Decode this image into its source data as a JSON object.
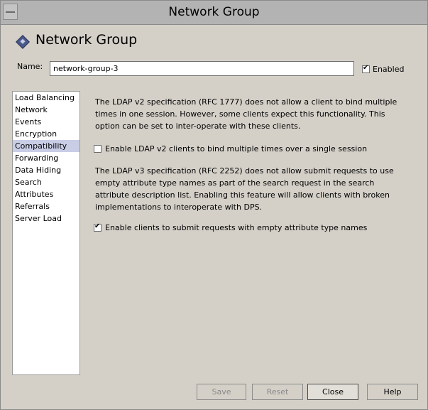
{
  "window": {
    "title": "Network Group"
  },
  "header": {
    "title": "Network Group"
  },
  "name_field": {
    "label": "Name:",
    "value": "network-group-3"
  },
  "enabled_checkbox": {
    "label": "Enabled",
    "checked": true
  },
  "sidebar": {
    "selected": "Compatibility",
    "items": [
      {
        "label": "Load Balancing"
      },
      {
        "label": "Network"
      },
      {
        "label": "Events"
      },
      {
        "label": "Encryption"
      },
      {
        "label": "Compatibility"
      },
      {
        "label": "Forwarding"
      },
      {
        "label": "Data Hiding"
      },
      {
        "label": "Search"
      },
      {
        "label": "Attributes"
      },
      {
        "label": "Referrals"
      },
      {
        "label": "Server Load"
      }
    ]
  },
  "compat": {
    "v2_desc_lines": [
      "The LDAP v2 specification (RFC 1777) does not allow a client to bind multiple",
      "times in one session. However, some clients expect this functionality. This",
      "option can be set to inter-operate with these clients."
    ],
    "v2_option": {
      "label": "Enable LDAP v2 clients to bind multiple times over a single session",
      "checked": false
    },
    "v3_desc_lines": [
      "The LDAP v3 specification (RFC 2252) does not allow submit requests to use",
      "empty attribute type names as part of the search request in the search",
      "attribute description list. Enabling this feature will allow clients with broken",
      "implementations to interoperate with DPS."
    ],
    "v3_option": {
      "label": "Enable clients to submit requests with empty attribute type names",
      "checked": true
    }
  },
  "buttons": {
    "save": {
      "label": "Save",
      "enabled": false
    },
    "reset": {
      "label": "Reset",
      "enabled": false
    },
    "close": {
      "label": "Close",
      "enabled": true
    },
    "help": {
      "label": "Help",
      "enabled": true
    }
  }
}
